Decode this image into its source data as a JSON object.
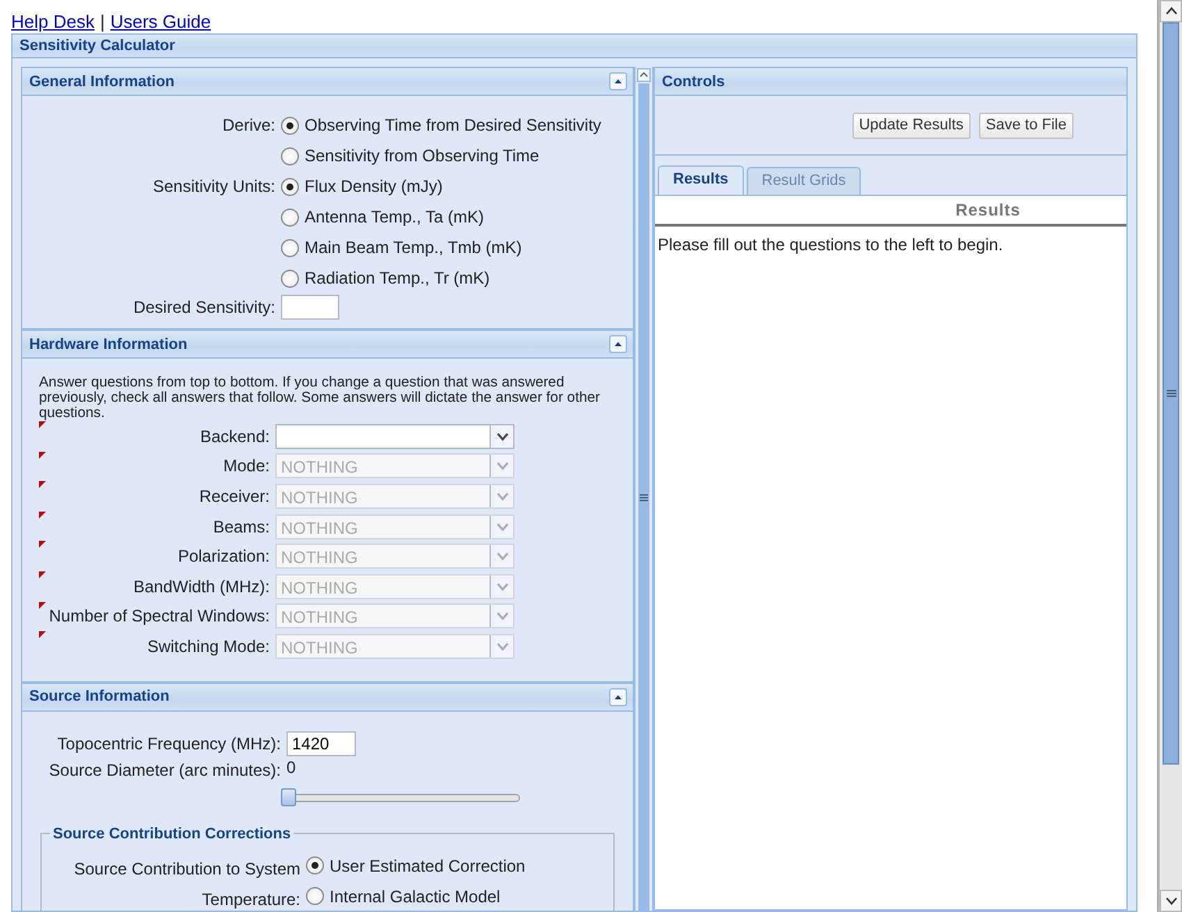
{
  "links": [
    {
      "label": "Help Desk"
    },
    {
      "label": "Users Guide"
    }
  ],
  "separator": "|",
  "calculator": {
    "title": "Sensitivity Calculator"
  },
  "general": {
    "title": "General Information",
    "groups": [
      {
        "label": "Derive:",
        "options": [
          {
            "label": "Observing Time from Desired Sensitivity",
            "selected": true
          },
          {
            "label": "Sensitivity from Observing Time",
            "selected": false
          }
        ]
      },
      {
        "label": "Sensitivity Units:",
        "options": [
          {
            "label": "Flux Density (mJy)",
            "selected": true
          },
          {
            "label": "Antenna Temp., Ta (mK)",
            "selected": false
          },
          {
            "label": "Main Beam Temp., Tmb (mK)",
            "selected": false
          },
          {
            "label": "Radiation Temp., Tr (mK)",
            "selected": false
          }
        ]
      }
    ],
    "desired_sensitivity": {
      "label": "Desired Sensitivity:"
    }
  },
  "hardware": {
    "title": "Hardware Information",
    "instructions": "Answer questions from top to bottom. If you change a question that was answered previously, check all answers that follow. Some answers will dictate the answer for other questions.",
    "fields": [
      {
        "label": "Backend:",
        "disabled": false
      },
      {
        "label": "Mode:",
        "value": "NOTHING",
        "disabled": true
      },
      {
        "label": "Receiver:",
        "value": "NOTHING",
        "disabled": true
      },
      {
        "label": "Beams:",
        "value": "NOTHING",
        "disabled": true
      },
      {
        "label": "Polarization:",
        "value": "NOTHING",
        "disabled": true
      },
      {
        "label": "BandWidth (MHz):",
        "value": "NOTHING",
        "disabled": true
      },
      {
        "label": "Number of Spectral Windows:",
        "value": "NOTHING",
        "disabled": true
      },
      {
        "label": "Switching Mode:",
        "value": "NOTHING",
        "disabled": true
      }
    ]
  },
  "source": {
    "title": "Source Information",
    "frequency": {
      "label": "Topocentric Frequency (MHz):",
      "value": "1420"
    },
    "diameter": {
      "label": "Source Diameter (arc minutes):",
      "value": "0",
      "level": 0
    },
    "corrections": {
      "title": "Source Contribution Corrections",
      "label": "Source Contribution to System Temperature:",
      "options": [
        {
          "label": "User Estimated Correction",
          "selected": true
        },
        {
          "label": "Internal Galactic Model",
          "selected": false
        }
      ]
    }
  },
  "controls": {
    "title": "Controls",
    "buttons": [
      "Update Results",
      "Save to File"
    ],
    "tabs": [
      {
        "label": "Results",
        "selected": true
      },
      {
        "label": "Result Grids",
        "selected": false
      }
    ],
    "results": {
      "heading": "Results",
      "message": "Please fill out the questions to the left to begin."
    }
  }
}
